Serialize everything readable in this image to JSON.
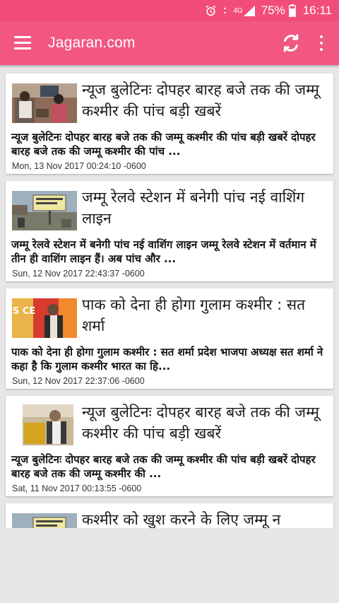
{
  "status": {
    "network": "4G",
    "battery": "75%",
    "time": "16:11"
  },
  "appbar": {
    "title": "Jagaran.com"
  },
  "articles": [
    {
      "headline": "न्यूज बुलेटिनः दोपहर बारह बजे तक की जम्मू कश्मीर की पांच बड़ी खबरें",
      "desc": "न्यूज बुलेटिनः दोपहर बारह बजे तक की जम्मू कश्मीर की पांच बड़ी खबरें दोपहर बारह बजे तक की जम्मू कश्मीर की पांच ...",
      "date": "Mon, 13 Nov 2017 00:24:10 -0600"
    },
    {
      "headline": "जम्मू रेलवे स्टेशन में बनेगी पांच नई वाशिंग लाइन",
      "desc": "जम्मू रेलवे स्टेशन में बनेगी पांच नई वाशिंग लाइन  जम्मू रेलवे स्टेशन में वर्तमान में तीन ही वाशिंग लाइन हैं। अब पांच और ...",
      "date": "Sun, 12 Nov 2017 22:43:37 -0600"
    },
    {
      "headline": "पाक को देना ही होगा गुलाम कश्मीर : सत शर्मा",
      "desc": "पाक को देना ही होगा गुलाम कश्मीर : सत शर्मा प्रदेश भाजपा अध्यक्ष सत शर्मा ने कहा है कि गुलाम कश्मीर भारत का हि...",
      "date": "Sun, 12 Nov 2017 22:37:06 -0600"
    },
    {
      "headline": "न्यूज बुलेटिनः दोपहर बारह बजे तक की जम्मू कश्मीर की पांच बड़ी खबरें",
      "desc": "न्यूज बुलेटिनः दोपहर बारह बजे तक की जम्मू कश्मीर की पांच बड़ी खबरें  दोपहर बारह बजे तक की जम्मू कश्मीर की ...",
      "date": "Sat, 11 Nov 2017 00:13:55 -0600"
    },
    {
      "headline": "कश्मीर को खुश करने के लिए जम्मू न"
    }
  ],
  "icons": {
    "alarm": "alarm-icon",
    "signal": "signal-icon",
    "battery": "battery-icon",
    "menu": "menu-icon",
    "refresh": "refresh-icon",
    "more": "more-vert-icon"
  },
  "colors": {
    "primary": "#f25782",
    "statusbar": "#f24d7a",
    "background": "#e6e6e6"
  }
}
